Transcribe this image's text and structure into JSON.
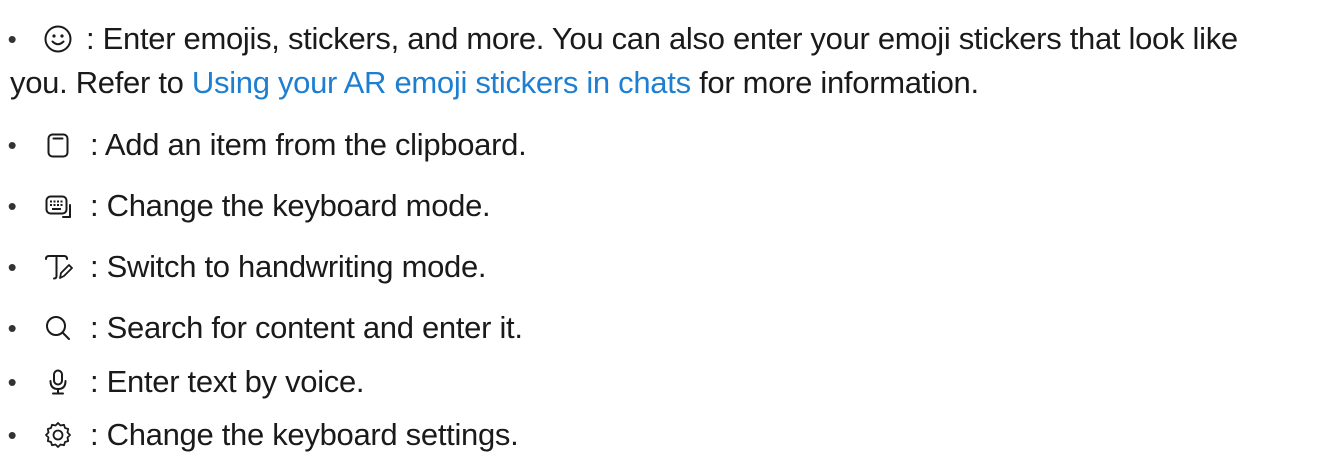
{
  "items": [
    {
      "icon": "smiley-face-icon",
      "text_before": ": Enter emojis, stickers, and more. You can also enter your emoji stickers that look like",
      "text_line2_before": "you. Refer to ",
      "link": "Using your AR emoji stickers in chats",
      "text_after": " for more information."
    },
    {
      "icon": "clipboard-icon",
      "text": ": Add an item from the clipboard."
    },
    {
      "icon": "keyboard-icon",
      "text": ": Change the keyboard mode."
    },
    {
      "icon": "handwriting-icon",
      "text": ": Switch to handwriting mode."
    },
    {
      "icon": "search-icon",
      "text": ": Search for content and enter it."
    },
    {
      "icon": "microphone-icon",
      "text": ": Enter text by voice."
    },
    {
      "icon": "gear-icon",
      "text": ": Change the keyboard settings."
    }
  ],
  "bullet": "•",
  "colors": {
    "text": "#1a1a1a",
    "link": "#1e7fd1"
  }
}
